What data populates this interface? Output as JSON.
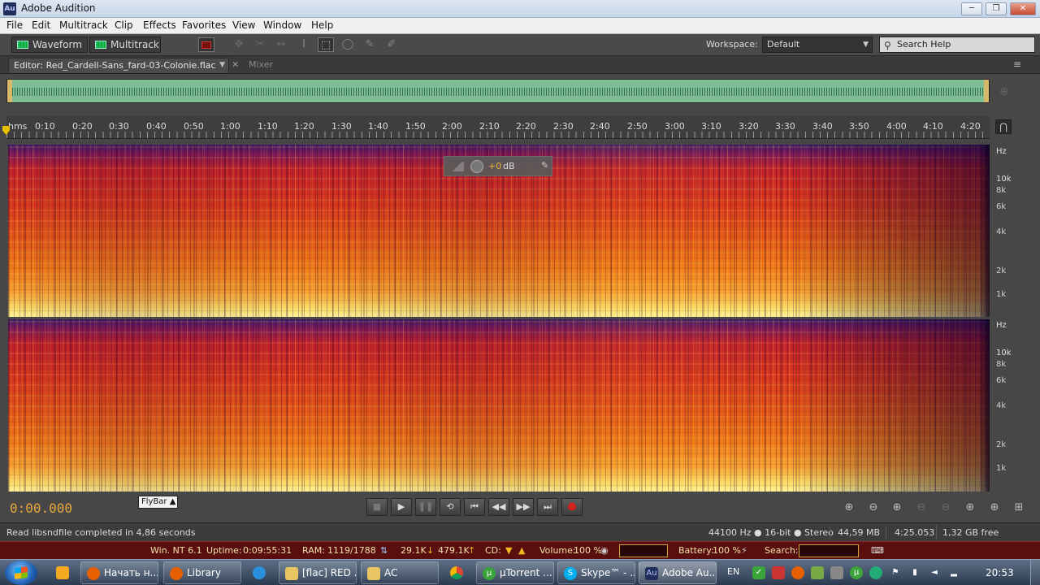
{
  "window": {
    "app_icon": "Au",
    "title": "Adobe Audition",
    "controls": [
      "─",
      "❐",
      "✕"
    ]
  },
  "menu": [
    "File",
    "Edit",
    "Multitrack",
    "Clip",
    "Effects",
    "Favorites",
    "View",
    "Window",
    "Help"
  ],
  "toolbar": {
    "waveform_label": "Waveform",
    "multitrack_label": "Multitrack",
    "workspace_label": "Workspace:",
    "workspace_value": "Default",
    "search_placeholder": "Search Help"
  },
  "panel": {
    "editor_tab": "Editor: Red_Cardell-Sans_fard-03-Colonie.flac",
    "mixer_tab": "Mixer"
  },
  "ruler": {
    "unit": "hms",
    "labels": [
      "0:10",
      "0:20",
      "0:30",
      "0:40",
      "0:50",
      "1:00",
      "1:10",
      "1:20",
      "1:30",
      "1:40",
      "1:50",
      "2:00",
      "2:10",
      "2:20",
      "2:30",
      "2:40",
      "2:50",
      "3:00",
      "3:10",
      "3:20",
      "3:30",
      "3:40",
      "3:50",
      "4:00",
      "4:10",
      "4:20"
    ]
  },
  "freq_axis": {
    "unit": "Hz",
    "labels": [
      "10k",
      "8k",
      "6k",
      "4k",
      "2k",
      "1k"
    ]
  },
  "hud": {
    "value": "+0",
    "unit": "dB"
  },
  "flybar": "FlyBar",
  "timecode": "0:00.000",
  "status": {
    "message": "Read libsndfile completed in 4,86 seconds",
    "format": "44100 Hz ● 16-bit ● Stereo",
    "size": "44,59 MB",
    "duration": "4:25.053",
    "free": "1,32 GB free"
  },
  "sysbar": {
    "os": "Win. NT 6.1",
    "uptime_label": "Uptime:",
    "uptime": "0:09:55:31",
    "ram_label": "RAM:",
    "ram": "1119/1788",
    "down": "29.1K",
    "up": "479.1K",
    "cd_label": "CD:",
    "volume_label": "Volume:",
    "volume": "100 %",
    "battery_label": "Battery:",
    "battery": "100 %",
    "search_label": "Search:"
  },
  "taskbar": {
    "items": [
      "Начать н...",
      "Library",
      "[flac] RED ...",
      "AC",
      "µTorrent ...",
      "Skype™ - ...",
      "Adobe Au..."
    ],
    "lang": "EN",
    "clock": "20:53"
  },
  "colors": {
    "accent_timecode": "#e8a93a",
    "waveform_overview": "#7fbf97",
    "sysbar_bg": "#5a0f0f"
  }
}
